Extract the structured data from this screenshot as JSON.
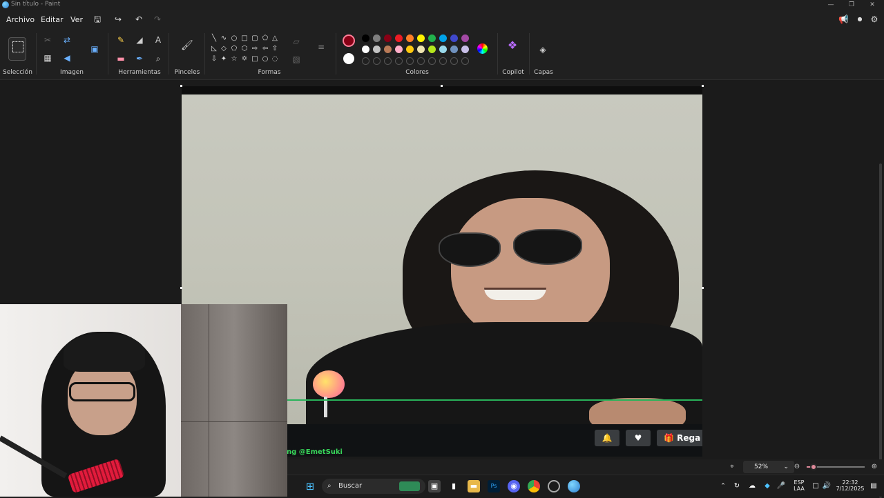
{
  "window": {
    "title": "Sin título - Paint",
    "minimize": "—",
    "restore": "❐",
    "close": "✕"
  },
  "menu": {
    "file": "Archivo",
    "edit": "Editar",
    "view": "Ver"
  },
  "ribbon": {
    "groups": {
      "selection": "Selección",
      "image": "Imagen",
      "tools": "Herramientas",
      "brushes": "Pinceles",
      "shapes": "Formas",
      "colors": "Colores",
      "copilot": "Copilot",
      "layers": "Capas"
    },
    "palette_row1": [
      "#000000",
      "#7f7f7f",
      "#880015",
      "#ed1c24",
      "#ff7f27",
      "#fff200",
      "#22b14c",
      "#00a2e8",
      "#3f48cc",
      "#a349a4"
    ],
    "palette_row2": [
      "#ffffff",
      "#c3c3c3",
      "#b97a57",
      "#ffaec9",
      "#ffc90e",
      "#efe4b0",
      "#b5e61d",
      "#99d9ea",
      "#7092be",
      "#c8bfe7"
    ],
    "primary_color": "#880015",
    "secondary_color": "#ffffff"
  },
  "stream": {
    "handle": "ng @EmetSuki",
    "gift_label": "Rega"
  },
  "status": {
    "zoom": "52%",
    "zoom_fraction": 0.12
  },
  "taskbar": {
    "search": "Buscar",
    "lang1": "ESP",
    "lang2": "LAA",
    "time": "22:32",
    "date": "7/12/2025"
  }
}
